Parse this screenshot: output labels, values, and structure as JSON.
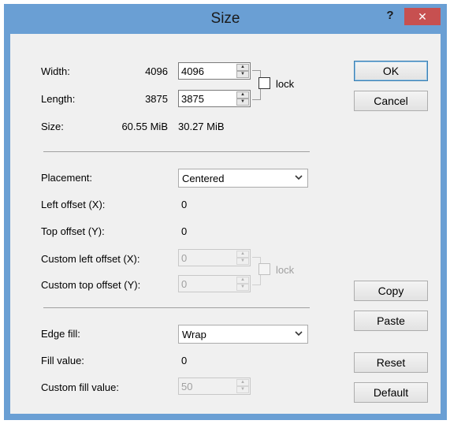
{
  "window": {
    "title": "Size",
    "help_label": "?",
    "close_label": "✕"
  },
  "dimensions": {
    "width_label": "Width:",
    "width_current": "4096",
    "width_value": "4096",
    "length_label": "Length:",
    "length_current": "3875",
    "length_value": "3875",
    "size_label": "Size:",
    "size_current": "60.55 MiB",
    "size_new": "30.27 MiB",
    "lock_label": "lock",
    "lock_checked": false
  },
  "placement": {
    "placement_label": "Placement:",
    "placement_value": "Centered",
    "left_offset_label": "Left offset (X):",
    "left_offset_value": "0",
    "top_offset_label": "Top offset (Y):",
    "top_offset_value": "0",
    "custom_left_label": "Custom left offset (X):",
    "custom_left_value": "0",
    "custom_top_label": "Custom top offset (Y):",
    "custom_top_value": "0",
    "lock_label": "lock"
  },
  "edge": {
    "edge_fill_label": "Edge fill:",
    "edge_fill_value": "Wrap",
    "fill_value_label": "Fill value:",
    "fill_value": "0",
    "custom_fill_label": "Custom fill value:",
    "custom_fill_value": "50"
  },
  "buttons": {
    "ok": "OK",
    "cancel": "Cancel",
    "copy": "Copy",
    "paste": "Paste",
    "reset": "Reset",
    "default": "Default"
  },
  "colors": {
    "titlebar": "#6a9fd4",
    "close_button": "#c75050",
    "client_background": "#f0f0f0"
  }
}
